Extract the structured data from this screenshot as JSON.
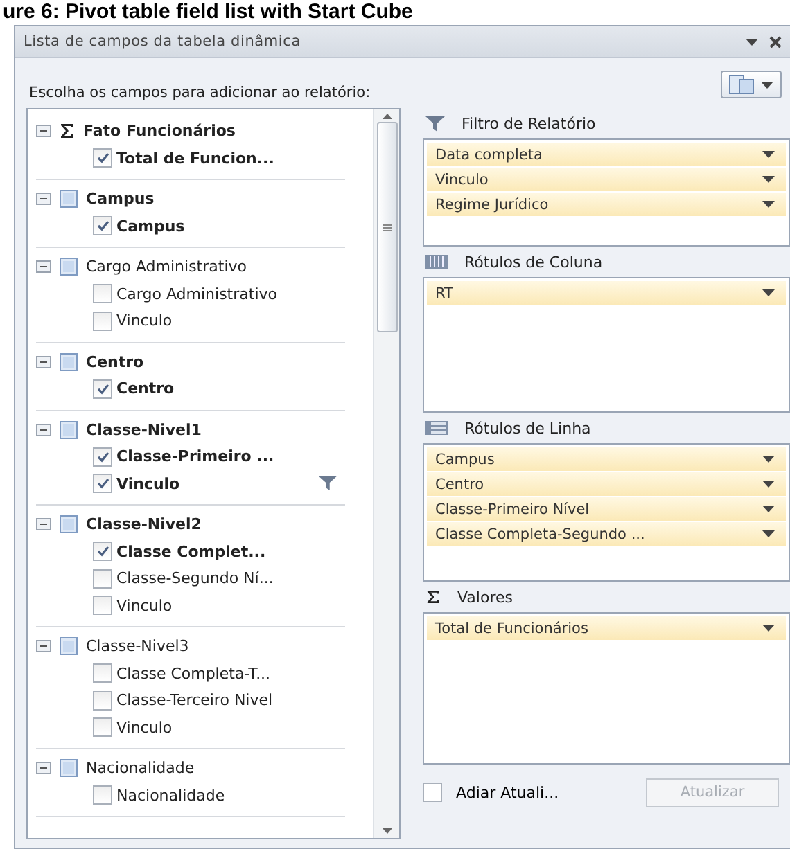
{
  "caption": "ure 6: Pivot table field list with Start Cube",
  "window": {
    "title": "Lista de campos da tabela dinâmica"
  },
  "prompt": "Escolha os campos para adicionar ao relatório:",
  "fields": [
    {
      "label": "Fato Funcionários",
      "kind": "measure",
      "expanded": true,
      "children": [
        {
          "label": "Total de Funcion...",
          "checked": true,
          "filtered": false
        }
      ]
    },
    {
      "label": "Campus",
      "kind": "dimension",
      "expanded": true,
      "children": [
        {
          "label": "Campus",
          "checked": true,
          "filtered": false
        }
      ]
    },
    {
      "label": "Cargo Administrativo",
      "kind": "dimension",
      "expanded": true,
      "children": [
        {
          "label": "Cargo Administrativo",
          "checked": false,
          "filtered": false
        },
        {
          "label": "Vinculo",
          "checked": false,
          "filtered": false
        }
      ]
    },
    {
      "label": "Centro",
      "kind": "dimension",
      "expanded": true,
      "children": [
        {
          "label": "Centro",
          "checked": true,
          "filtered": false
        }
      ]
    },
    {
      "label": "Classe-Nivel1",
      "kind": "dimension",
      "expanded": true,
      "children": [
        {
          "label": "Classe-Primeiro ...",
          "checked": true,
          "filtered": false
        },
        {
          "label": "Vinculo",
          "checked": true,
          "filtered": true
        }
      ]
    },
    {
      "label": "Classe-Nivel2",
      "kind": "dimension",
      "expanded": true,
      "children": [
        {
          "label": "Classe Complet...",
          "checked": true,
          "filtered": false
        },
        {
          "label": "Classe-Segundo Ní...",
          "checked": false,
          "filtered": false
        },
        {
          "label": "Vinculo",
          "checked": false,
          "filtered": false
        }
      ]
    },
    {
      "label": "Classe-Nivel3",
      "kind": "dimension",
      "expanded": true,
      "children": [
        {
          "label": "Classe Completa-T...",
          "checked": false,
          "filtered": false
        },
        {
          "label": "Classe-Terceiro Nivel",
          "checked": false,
          "filtered": false
        },
        {
          "label": "Vinculo",
          "checked": false,
          "filtered": false
        }
      ]
    },
    {
      "label": "Nacionalidade",
      "kind": "dimension",
      "expanded": true,
      "children": [
        {
          "label": "Nacionalidade",
          "checked": false,
          "filtered": false
        }
      ]
    }
  ],
  "areas": [
    {
      "kind": "filter",
      "title": "Filtro de Relatório",
      "items": [
        "Data completa",
        "Vinculo",
        "Regime Jurídico"
      ]
    },
    {
      "kind": "columns",
      "title": "Rótulos de Coluna",
      "items": [
        "RT"
      ]
    },
    {
      "kind": "rows",
      "title": "Rótulos de Linha",
      "items": [
        "Campus",
        "Centro",
        "Classe-Primeiro Nível",
        "Classe Completa-Segundo ..."
      ]
    },
    {
      "kind": "values",
      "title": "Valores",
      "items": [
        "Total de Funcionários"
      ]
    }
  ],
  "defer": {
    "label": "Adiar Atuali...",
    "checked": false
  },
  "update_button": {
    "label": "Atualizar",
    "disabled": true
  }
}
